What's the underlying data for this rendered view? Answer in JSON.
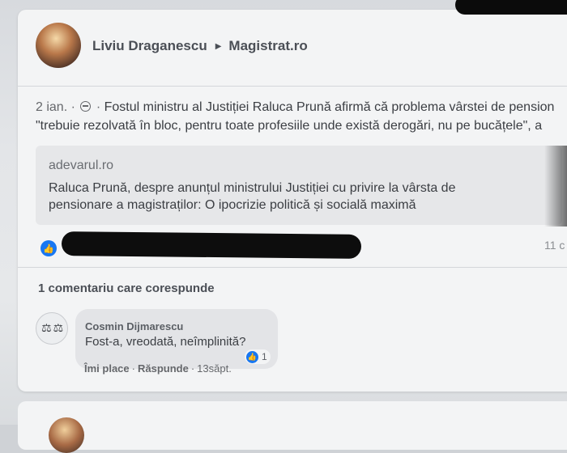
{
  "post": {
    "author": "Liviu Draganescu",
    "group": "Magistrat.ro",
    "date": "2 ian.",
    "text_line1": "Fostul ministru al Justiției Raluca Prună afirmă că problema vârstei de pension",
    "text_line2": "\"trebuie rezolvată în bloc, pentru toate profesiile unde există derogări, nu pe bucățele\", a",
    "link": {
      "source": "adevarul.ro",
      "title": "Raluca Prună, despre anunțul ministrului Justiției cu privire la vârsta de pensionare a magistraților: O ipocrizie politică și socială maximă"
    },
    "reactions_right": "11 c"
  },
  "comments": {
    "header": "1 comentariu care corespunde",
    "items": [
      {
        "author": "Cosmin Dijmarescu",
        "text": "Fost-a, vreodată, neîmplinită?",
        "reaction_count": "1",
        "like_label": "Îmi place",
        "reply_label": "Răspunde",
        "time": "13săpt."
      }
    ]
  },
  "icons": {
    "separator_arrow": "caret-right-icon",
    "privacy": "globe-icon",
    "reaction": "thumbs-up-icon"
  },
  "colors": {
    "accent": "#1877f2",
    "card": "#f3f4f5"
  }
}
